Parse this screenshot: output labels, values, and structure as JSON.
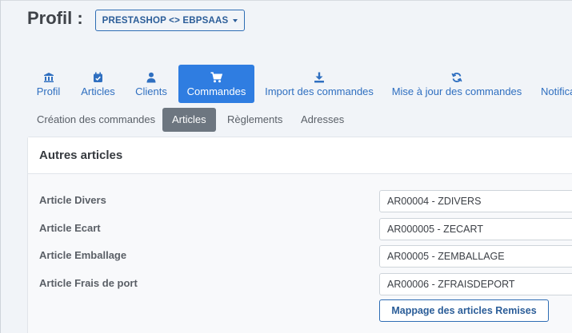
{
  "header": {
    "title": "Profil :",
    "profile_select": "PRESTASHOP <> EBPSAAS"
  },
  "tabs": [
    {
      "label": "Profil",
      "icon": "bank-icon"
    },
    {
      "label": "Articles",
      "icon": "calendar-check-icon"
    },
    {
      "label": "Clients",
      "icon": "user-icon"
    },
    {
      "label": "Commandes",
      "icon": "shopping-cart-icon",
      "active": true
    },
    {
      "label": "Import des commandes",
      "icon": "download-icon"
    },
    {
      "label": "Mise à jour des commandes",
      "icon": "refresh-icon"
    },
    {
      "label": "Notifica",
      "icon": ""
    }
  ],
  "subtabs": [
    {
      "label": "Création des commandes"
    },
    {
      "label": "Articles",
      "active": true
    },
    {
      "label": "Règlements"
    },
    {
      "label": "Adresses"
    }
  ],
  "card": {
    "title": "Autres articles",
    "rows": [
      {
        "label": "Article Divers",
        "value": "AR00004 - ZDIVERS"
      },
      {
        "label": "Article Ecart",
        "value": "AR000005 - ZECART"
      },
      {
        "label": "Article Emballage",
        "value": "AR00005 - ZEMBALLAGE"
      },
      {
        "label": "Article Frais de port",
        "value": "AR00006 - ZFRAISDEPORT"
      }
    ],
    "mapping_button": "Mappage des articles Remises"
  },
  "colors": {
    "accent": "#2f7de1",
    "link": "#2f6fc0",
    "subtab_active": "#6d7680",
    "background": "#f1f4f8"
  }
}
